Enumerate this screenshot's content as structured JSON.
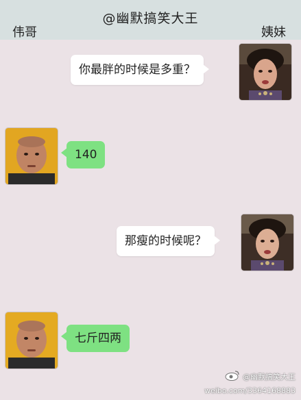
{
  "header": {
    "title": "@幽默搞笑大王",
    "left_name": "伟哥",
    "right_name": "姨妹"
  },
  "messages": [
    {
      "sender": "姨妹",
      "side": "right",
      "text": "你最胖的时候是多重？"
    },
    {
      "sender": "伟哥",
      "side": "left",
      "text": "140"
    },
    {
      "sender": "姨妹",
      "side": "right",
      "text": "那瘦的时候呢？"
    },
    {
      "sender": "伟哥",
      "side": "left",
      "text": "七斤四两"
    }
  ],
  "watermark": {
    "handle": "@幽默搞笑大王",
    "url": "weibo.com/3364168883"
  },
  "colors": {
    "background": "#ebe2e6",
    "header": "#d7e0e0",
    "bubble_white": "#ffffff",
    "bubble_green": "#7ee182"
  },
  "icons": [
    "avatar-woman",
    "avatar-man",
    "weibo-logo-icon"
  ]
}
